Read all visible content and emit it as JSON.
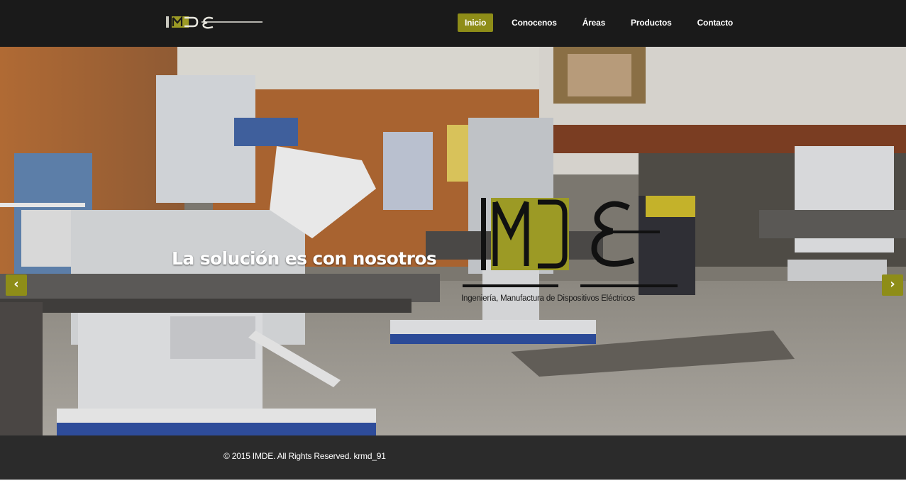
{
  "brand": {
    "logo_text": "IMDE",
    "accent_color": "#8e8d18"
  },
  "nav": {
    "items": [
      {
        "label": "Inicio",
        "active": true
      },
      {
        "label": "Conocenos",
        "active": false
      },
      {
        "label": "Áreas",
        "active": false
      },
      {
        "label": "Productos",
        "active": false
      },
      {
        "label": "Contacto",
        "active": false
      }
    ]
  },
  "slider": {
    "caption": "La solución es con nosotros",
    "overlay_logo_text": "IMDE",
    "overlay_tagline": "Ingeniería, Manufactura de Dispositivos Eléctricos",
    "prev_icon": "chevron-left-icon",
    "next_icon": "chevron-right-icon",
    "prev_glyph": "‹",
    "next_glyph": "›",
    "dots": [
      {
        "active": true
      },
      {
        "active": false
      },
      {
        "active": false
      }
    ],
    "current_slide": 1,
    "total_slides": 3
  },
  "footer": {
    "copyright": "© 2015 IMDE. All Rights Reserved. krmd_91"
  }
}
